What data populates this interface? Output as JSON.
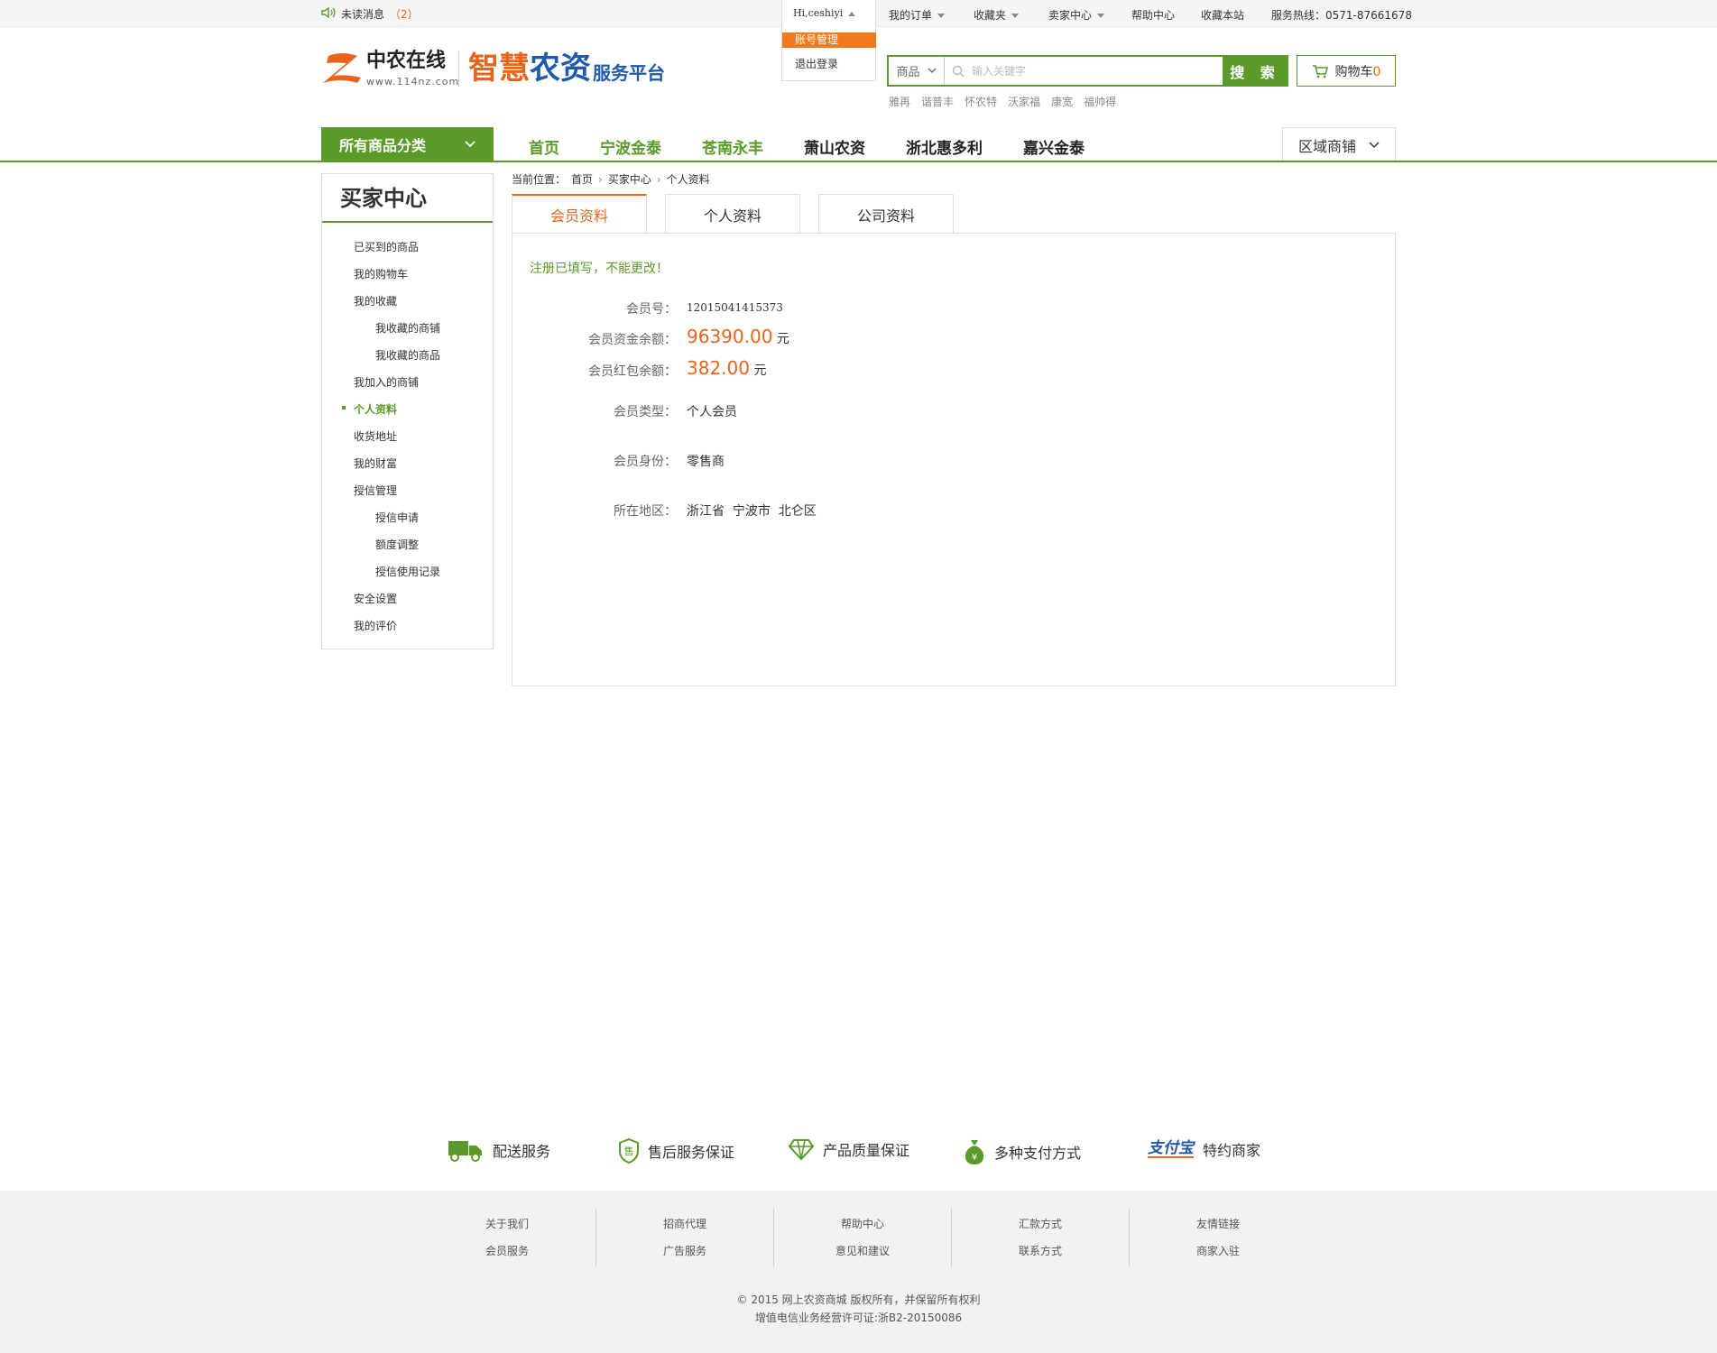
{
  "topbar": {
    "unread_label": "未读消息",
    "unread_count": "（2）",
    "user_greeting": "Hi,ceshiyi",
    "user_menu": [
      "账号管理",
      "退出登录"
    ],
    "my_orders": "我的订单",
    "favorites": "收藏夹",
    "seller_center": "卖家中心",
    "help_center": "帮助中心",
    "bookmark": "收藏本站",
    "hotline": "服务热线：0571-87661678"
  },
  "header": {
    "logo_brand": "中农在线",
    "logo_url": "www.114nz.com",
    "logo_main_orange": "智慧",
    "logo_main_blue": "农资",
    "logo_sub": "服务平台",
    "search_category": "商品",
    "search_placeholder": "输入关键字",
    "search_button": "搜 索",
    "cart_label": "购物车",
    "cart_count": "0",
    "hot_keywords": [
      "雅再",
      "谐普丰",
      "怀农特",
      "沃家福",
      "康宽",
      "福帅得"
    ]
  },
  "nav": {
    "all_categories": "所有商品分类",
    "items": [
      "首页",
      "宁波金泰",
      "苍南永丰",
      "萧山农资",
      "浙北惠多利",
      "嘉兴金泰"
    ],
    "region": "区域商铺",
    "colors": {
      "green": "#5a9a28",
      "orange": "#e8641b",
      "dark": "#222222"
    }
  },
  "sidebar": {
    "title": "买家中心",
    "items": [
      "已买到的商品",
      "我的购物车",
      "我的收藏",
      "我收藏的商铺",
      "我收藏的商品",
      "我加入的商铺",
      "个人资料",
      "收货地址",
      "我的财富",
      "授信管理",
      "授信申请",
      "额度调整",
      "授信使用记录",
      "安全设置",
      "我的评价"
    ],
    "active_item": "个人资料"
  },
  "main": {
    "breadcrumb": [
      "当前位置：",
      "首页",
      "买家中心",
      "个人资料"
    ],
    "tabs": [
      "会员资料",
      "个人资料",
      "公司资料"
    ],
    "notice": "注册已填写，不能更改！",
    "fields": {
      "member_no_label": "会员号：",
      "member_no": "12015041415373",
      "balance_label": "会员资金余额：",
      "balance": "96390.00",
      "red_label": "会员红包余额：",
      "red": "382.00",
      "unit": "元",
      "type_label": "会员类型：",
      "type": "个人会员",
      "identity_label": "会员身份：",
      "identity": "零售商",
      "region_label": "所在地区：",
      "region": "浙江省  宁波市  北仑区"
    }
  },
  "services": [
    "配送服务",
    "售后服务保证",
    "产品质量保证",
    "多种支付方式",
    "特约商家"
  ],
  "alipay_logo": "支付宝",
  "footer": {
    "columns": [
      [
        "关于我们",
        "会员服务"
      ],
      [
        "招商代理",
        "广告服务"
      ],
      [
        "帮助中心",
        "意见和建议"
      ],
      [
        "汇款方式",
        "联系方式"
      ],
      [
        "友情链接",
        "商家入驻"
      ]
    ],
    "copyright": "© 2015  网上农资商城  版权所有，并保留所有权利",
    "license": "增值电信业务经营许可证:浙B2-20150086"
  }
}
